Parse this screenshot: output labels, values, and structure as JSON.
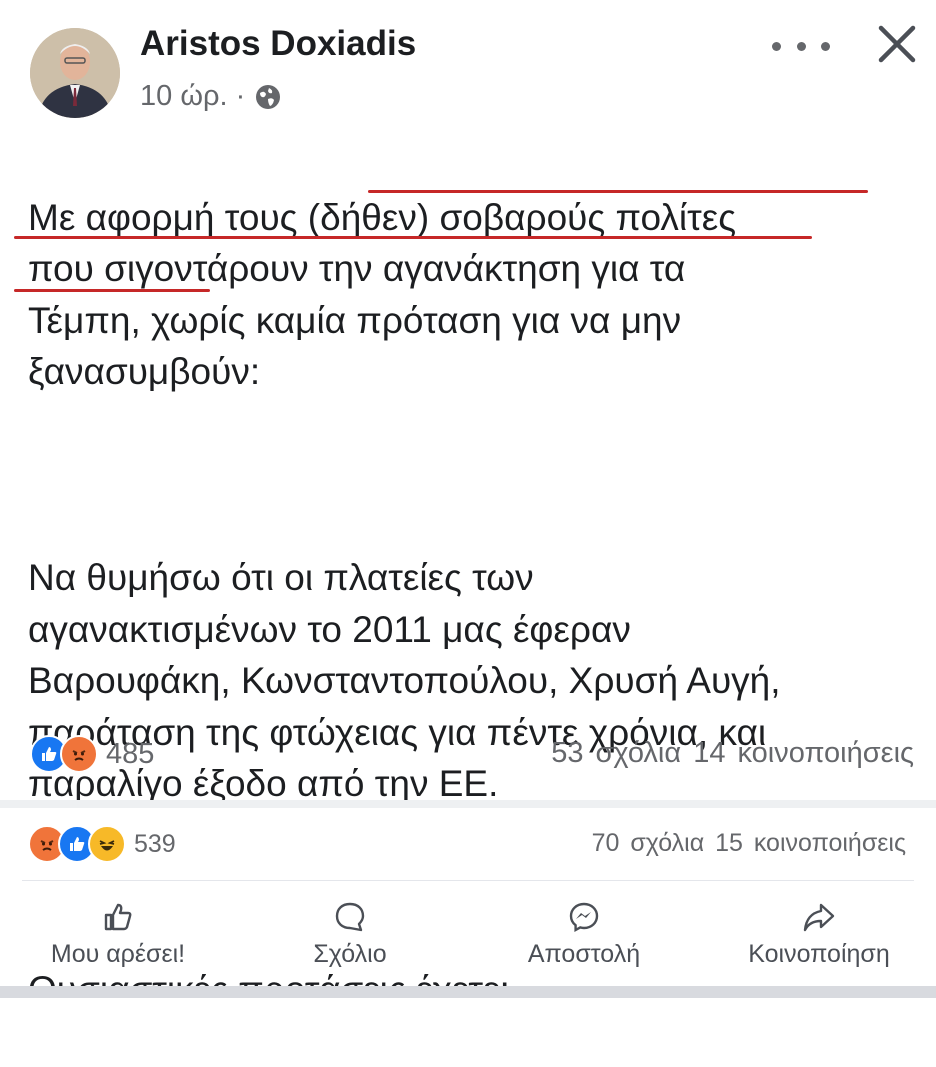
{
  "post": {
    "author": "Aristos Doxiadis",
    "time": "10 ώρ. ·",
    "paragraphs": [
      "Με αφορμή τους (δήθεν) σοβαρούς πολίτες\nπου σιγοντάρουν την αγανάκτηση για τα\nΤέμπη, χωρίς καμία πρόταση για να μην\nξανασυμβούν:",
      "Να θυμήσω ότι οι πλατείες των\nαγανακτισμένων  το 2011 μας έφεραν\nΒαρουφάκη, Κωνσταντοπούλου, Χρυσή Αυγή,\nπαράταση της φτώχειας για πέντε χρόνια, και\nπαραλίγο έξοδο από την ΕΕ.",
      "Ουσιαστικές προτάσεις έχετε;"
    ],
    "reactions_count": "485",
    "comments_shares": "53 σχόλια  14 κοινοποιήσεις"
  },
  "outer": {
    "reactions_count": "539",
    "comments_shares": "70 σχόλια  15 κοινοποιήσεις"
  },
  "actions": {
    "like": "Μου αρέσει!",
    "comment": "Σχόλιο",
    "send": "Αποστολή",
    "share": "Κοινοποίηση"
  },
  "colors": {
    "like_blue": "#1877f2",
    "angry_orange": "#f0743a",
    "haha_yellow": "#f7b928",
    "underline_red": "#c62828"
  },
  "icons": [
    "globe-icon",
    "more-icon",
    "close-icon",
    "like-reaction-icon",
    "angry-reaction-icon",
    "haha-reaction-icon",
    "thumbs-up-icon",
    "comment-icon",
    "messenger-icon",
    "share-icon"
  ]
}
